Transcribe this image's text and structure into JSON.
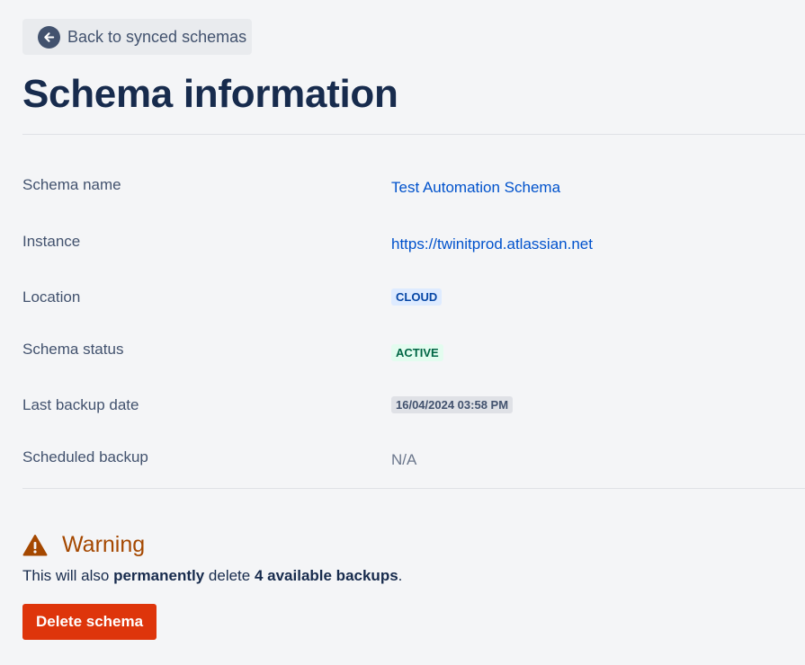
{
  "back_button": {
    "label": "Back to synced schemas",
    "icon": "arrow-left-circle-icon"
  },
  "page_title": "Schema information",
  "details": [
    {
      "label": "Schema name",
      "value": "Test Automation Schema",
      "type": "link"
    },
    {
      "label": "Instance",
      "value": "https://twinitprod.atlassian.net",
      "type": "link"
    },
    {
      "label": "Location",
      "value": "CLOUD",
      "type": "lozenge-blue"
    },
    {
      "label": "Schema status",
      "value": "ACTIVE",
      "type": "lozenge-green"
    },
    {
      "label": "Last backup date",
      "value": "16/04/2024 03:58 PM",
      "type": "lozenge-grey"
    },
    {
      "label": "Scheduled backup",
      "value": "N/A",
      "type": "text"
    }
  ],
  "warning": {
    "icon": "warning-triangle-icon",
    "title": "Warning",
    "text_part1": "This will also ",
    "text_bold1": "permanently",
    "text_part2": " delete ",
    "text_bold2": "4 available backups",
    "text_part3": "."
  },
  "delete_button": {
    "label": "Delete schema"
  },
  "colors": {
    "link": "#0052cc",
    "warning": "#a54800",
    "danger": "#de350b",
    "active": "#006644",
    "cloud": "#0747a6"
  }
}
